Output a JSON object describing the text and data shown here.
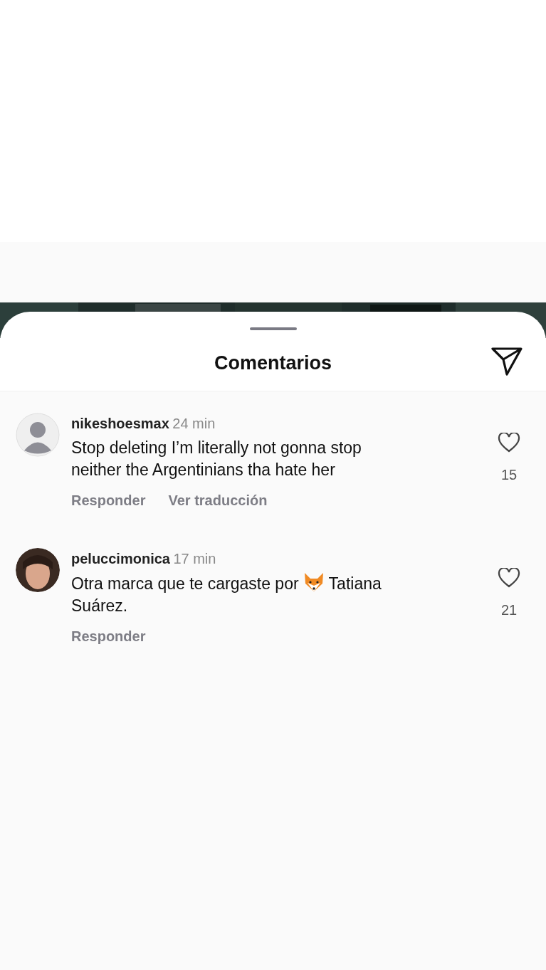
{
  "header": {
    "title": "Comentarios"
  },
  "comments": [
    {
      "username": "nikeshoesmax",
      "time": "24 min",
      "kind": "default",
      "segments": [
        {
          "kind": "text",
          "text": "Stop deleting I’m literally not gonna stop neither the Argentinians tha hate her"
        }
      ],
      "likes": "15",
      "liked": false,
      "actions": [
        "Responder",
        "Ver traducción"
      ]
    },
    {
      "username": "peluccimonica",
      "time": "17 min",
      "segments": [
        {
          "kind": "text",
          "text": "Otra marca que te cargaste por"
        },
        {
          "kind": "fox"
        },
        {
          "kind": "text",
          "text": "Tatiana"
        },
        {
          "kind": "text",
          "text": "Suárez."
        }
      ],
      "likes": "21",
      "liked": false,
      "actions": [
        "Responder"
      ]
    }
  ]
}
